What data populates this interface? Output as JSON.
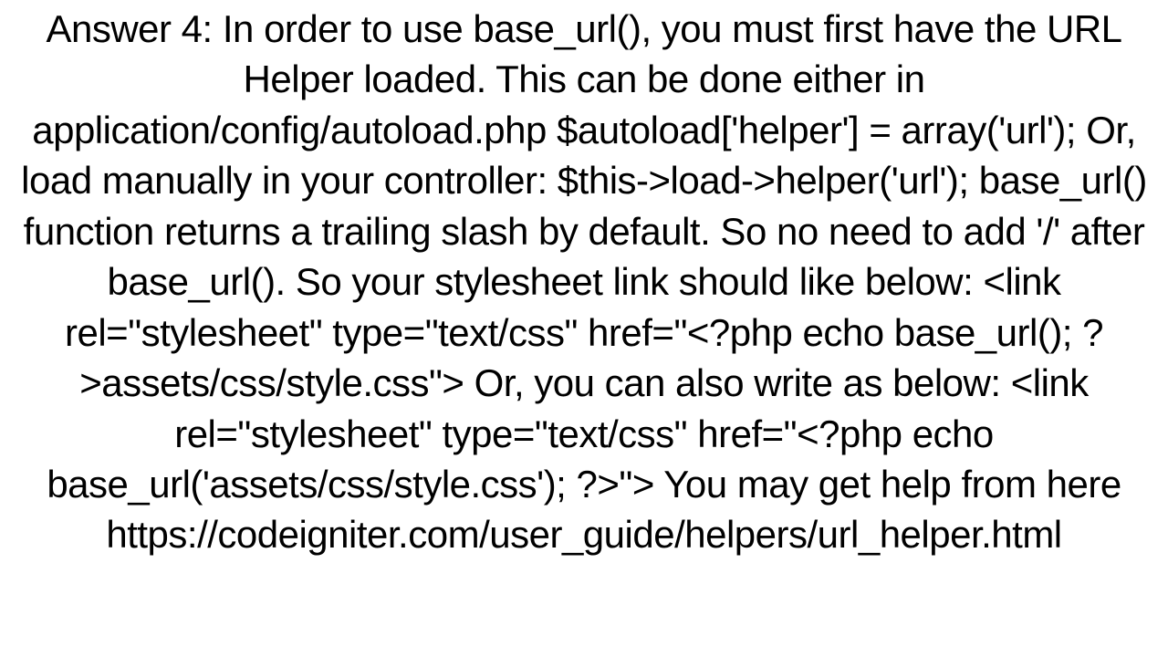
{
  "answer": {
    "text": "Answer 4: In order to use base_url(), you must first have the URL Helper loaded. This can be done either in application/config/autoload.php $autoload['helper'] = array('url');  Or, load manually in your controller: $this->load->helper('url');  base_url() function returns a trailing slash by default. So no need to add '/' after base_url(). So your stylesheet link should like below: <link rel=\"stylesheet\" type=\"text/css\" href=\"<?php echo base_url(); ?>assets/css/style.css\">  Or, you can also write as below: <link rel=\"stylesheet\" type=\"text/css\" href=\"<?php echo base_url('assets/css/style.css'); ?>\">  You may get help from here https://codeigniter.com/user_guide/helpers/url_helper.html"
  }
}
